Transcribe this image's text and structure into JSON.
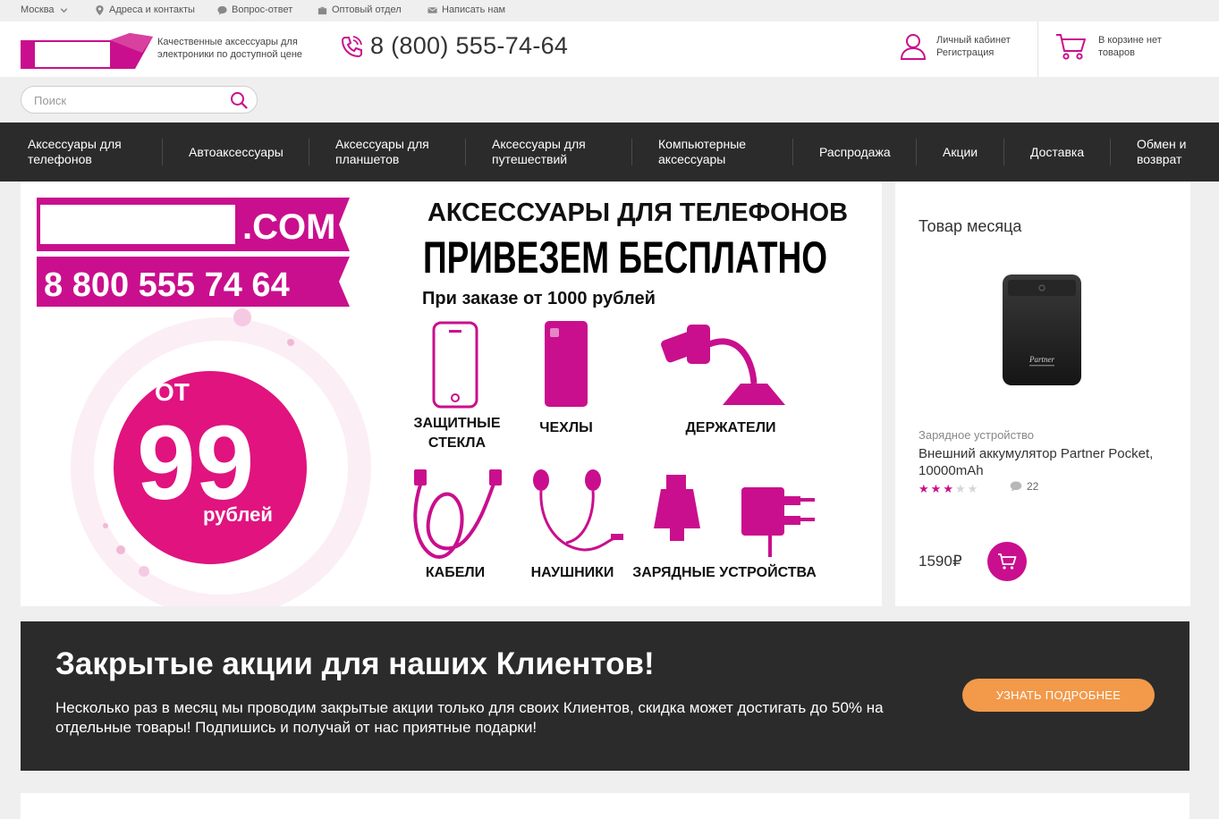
{
  "topbar": {
    "city": "Москва",
    "links": [
      {
        "label": "Адреса и контакты",
        "icon": "location-pin-icon"
      },
      {
        "label": "Вопрос-ответ",
        "icon": "chat-bubble-icon"
      },
      {
        "label": "Оптовый отдел",
        "icon": "briefcase-icon"
      },
      {
        "label": "Написать нам",
        "icon": "envelope-icon"
      }
    ]
  },
  "header": {
    "tagline": "Качественные аксессуары для электроники по доступной цене",
    "phone": "8 (800) 555-74-64",
    "account": {
      "line1": "Личный кабинет",
      "line2": "Регистрация"
    },
    "cart": {
      "text": "В корзине нет товаров"
    }
  },
  "search": {
    "placeholder": "Поиск"
  },
  "nav": {
    "items": [
      "Аксессуары для телефонов",
      "Автоаксессуары",
      "Аксессуары для планшетов",
      "Аксессуары для путешествий",
      "Компьютерные аксессуары",
      "Распродажа",
      "Акции",
      "Доставка",
      "Обмен и возврат"
    ]
  },
  "banner": {
    "domain": ".COM",
    "phone": "8 800 555 74 64",
    "price_prefix": "ОТ",
    "price_value": "99",
    "price_unit": "рублей",
    "headline1": "АКСЕССУАРЫ ДЛЯ ТЕЛЕФОНОВ",
    "headline2": "ПРИВЕЗЕМ БЕСПЛАТНО",
    "subline": "При заказе от 1000 рублей",
    "categories": {
      "glass_1": "ЗАЩИТНЫЕ",
      "glass_2": "СТЕКЛА",
      "cases": "ЧЕХЛЫ",
      "holders": "ДЕРЖАТЕЛИ",
      "cables": "КАБЕЛИ",
      "headphones": "НАУШНИКИ",
      "chargers": "ЗАРЯДНЫЕ УСТРОЙСТВА"
    },
    "brand_color": "#c90f8d"
  },
  "product_of_month": {
    "title": "Товар месяца",
    "category": "Зарядное устройство",
    "name": "Внешний аккумулятор Partner Pocket, 10000mAh",
    "rating": 3,
    "rating_max": 5,
    "reviews": "22",
    "price": "1590₽",
    "image_label": "Partner"
  },
  "promo": {
    "title": "Закрытые акции для наших Клиентов!",
    "text": "Несколько раз в месяц мы проводим закрытые акции только для своих Клиентов, скидка может достигать до 50% на отдельные товары! Подпишись и получай от нас приятные подарки!",
    "button": "УЗНАТЬ ПОДРОБНЕЕ",
    "button_color": "#f2994a"
  }
}
